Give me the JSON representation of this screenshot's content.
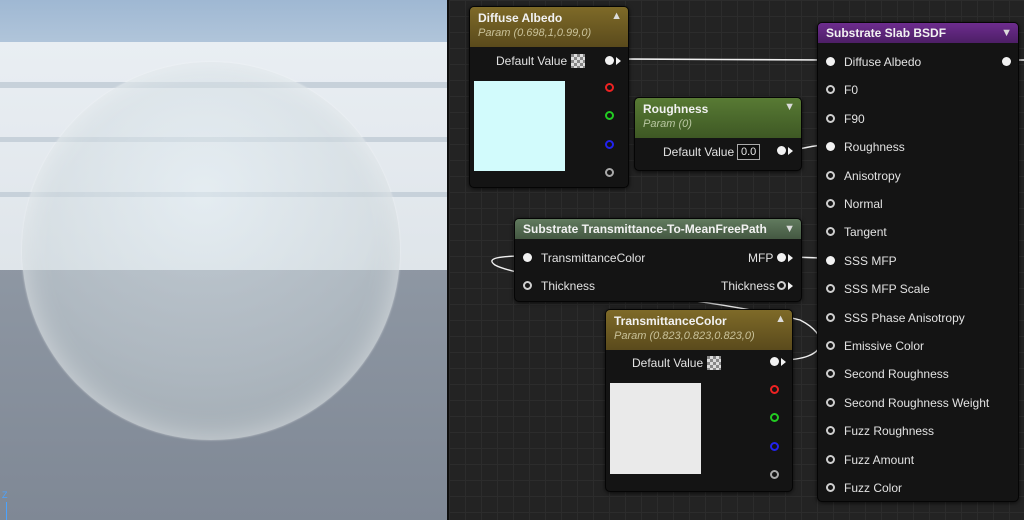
{
  "viewport": {
    "axis_label": "Z"
  },
  "nodes": {
    "diffuse_albedo": {
      "title": "Diffuse Albedo",
      "subtitle": "Param (0.698,1,0.99,0)",
      "default_value_label": "Default Value",
      "swatch_color": "#d2fbfc"
    },
    "roughness": {
      "title": "Roughness",
      "subtitle": "Param (0)",
      "default_value_label": "Default Value",
      "value": "0.0"
    },
    "transmittance_mfp": {
      "title": "Substrate Transmittance-To-MeanFreePath",
      "inputs": [
        "TransmittanceColor",
        "Thickness"
      ],
      "outputs": [
        "MFP",
        "Thickness"
      ]
    },
    "transmittance_color": {
      "title": "TransmittanceColor",
      "subtitle": "Param (0.823,0.823,0.823,0)",
      "default_value_label": "Default Value",
      "swatch_color": "#eaeaea"
    },
    "slab_bsdf": {
      "title": "Substrate Slab BSDF",
      "inputs": [
        "Diffuse Albedo",
        "F0",
        "F90",
        "Roughness",
        "Anisotropy",
        "Normal",
        "Tangent",
        "SSS MFP",
        "SSS MFP Scale",
        "SSS Phase Anisotropy",
        "Emissive Color",
        "Second Roughness",
        "Second Roughness Weight",
        "Fuzz Roughness",
        "Fuzz Amount",
        "Fuzz Color"
      ]
    }
  },
  "colors": {
    "header_gold": "#6e5c22",
    "header_green": "#4c6a2c",
    "header_purple": "#5d2679",
    "header_mint": "#556c52"
  }
}
